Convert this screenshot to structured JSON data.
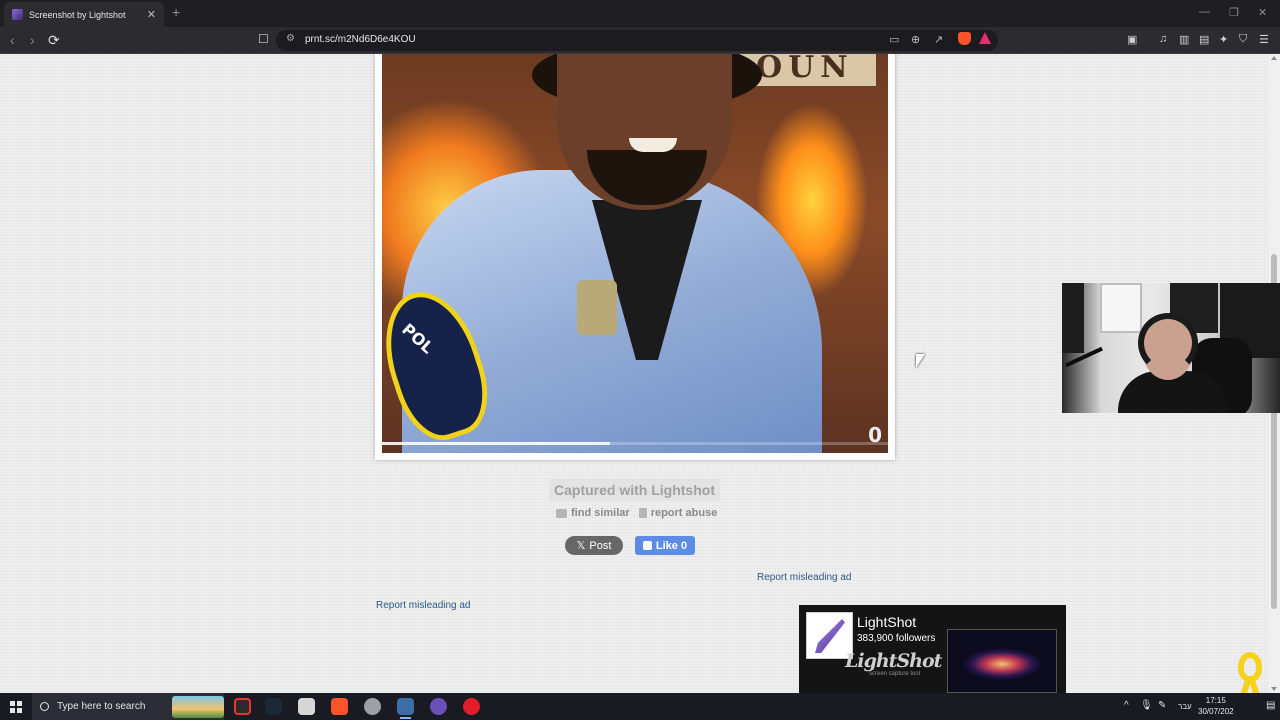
{
  "browser": {
    "tab_title": "Screenshot by Lightshot",
    "tab_close": "✕",
    "new_tab": "+",
    "url": "prnt.sc/m2Nd6D6e4KOU",
    "window_controls": [
      "—",
      "❐",
      "✕"
    ],
    "nav": {
      "back": "‹",
      "forward": "›",
      "reload": "⟳"
    }
  },
  "page": {
    "screenshot_image": {
      "sign_text": "OUN",
      "patch_text": "POL",
      "corner_counter": "0",
      "video_progress": 0.45
    },
    "captured_label": "Captured with Lightshot",
    "actions": [
      {
        "label": "find similar",
        "icon": "camera-icon"
      },
      {
        "label": "report abuse",
        "icon": "document-icon"
      }
    ],
    "social": {
      "x_post_label": "Post",
      "x_icon": "𝕏",
      "fb_like_label": "Like 0"
    },
    "ad_report_right": "Report misleading ad",
    "ad_report_left": "Report misleading ad",
    "fb_card": {
      "page_name": "LightShot",
      "followers": "383,900 followers",
      "brand_text": "LightShot",
      "brand_sub": "screen capture tool"
    }
  },
  "taskbar": {
    "search_placeholder": "Type here to search",
    "language": "עבר",
    "time": "17:15",
    "date": "30/07/202",
    "tray_chevron": "^"
  },
  "colors": {
    "link": "#2b5a86",
    "fb_blue": "#5d8ce4",
    "x_gray": "#676767",
    "ribbon": "#f5d21c"
  }
}
